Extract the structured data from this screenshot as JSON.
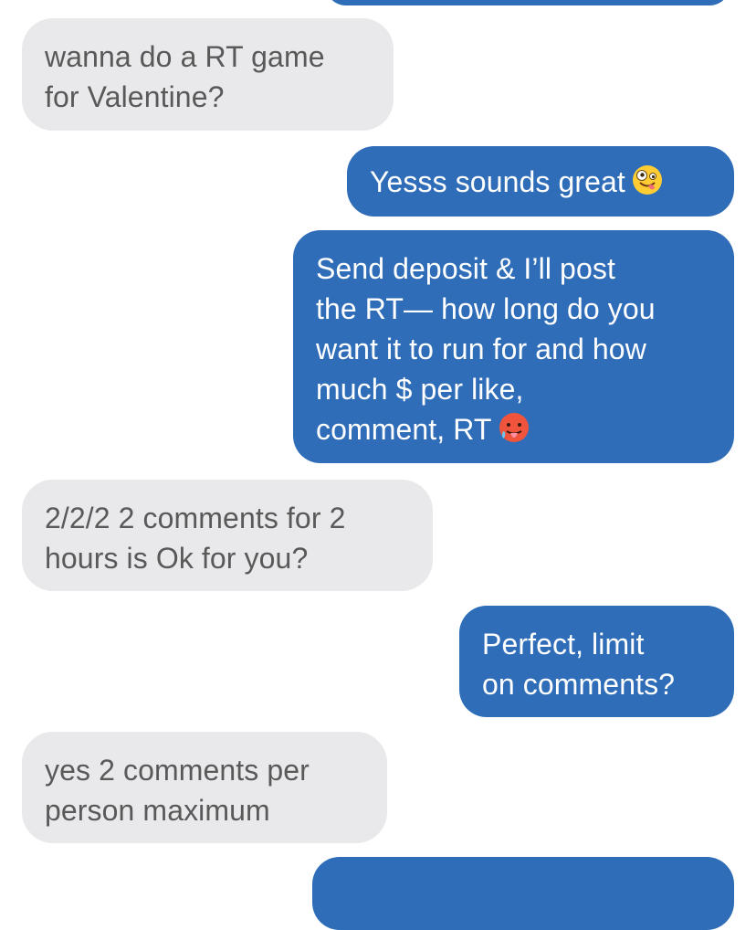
{
  "conversation": {
    "msg1": {
      "lines": [
        "wanna do a RT game",
        "for Valentine?"
      ]
    },
    "msg2": {
      "lines": [
        "Yesss sounds great"
      ],
      "emoji": "zany-face-emoji"
    },
    "msg3": {
      "lines": [
        "Send deposit & I’ll post",
        "the RT— how long do you",
        "want it to run for and how",
        "much $ per like,",
        "comment, RT"
      ],
      "emoji": "hot-face-emoji"
    },
    "msg4": {
      "lines": [
        "2/2/2 2 comments for 2",
        "hours is Ok for you?"
      ]
    },
    "msg5": {
      "lines": [
        "Perfect, limit",
        "on comments?"
      ]
    },
    "msg6": {
      "lines": [
        "yes 2 comments per",
        "person maximum"
      ]
    }
  },
  "colors": {
    "incoming_bubble": "#e9e9eb",
    "incoming_text": "#595959",
    "outgoing_bubble": "#2f6db8",
    "outgoing_text": "#ffffff"
  }
}
